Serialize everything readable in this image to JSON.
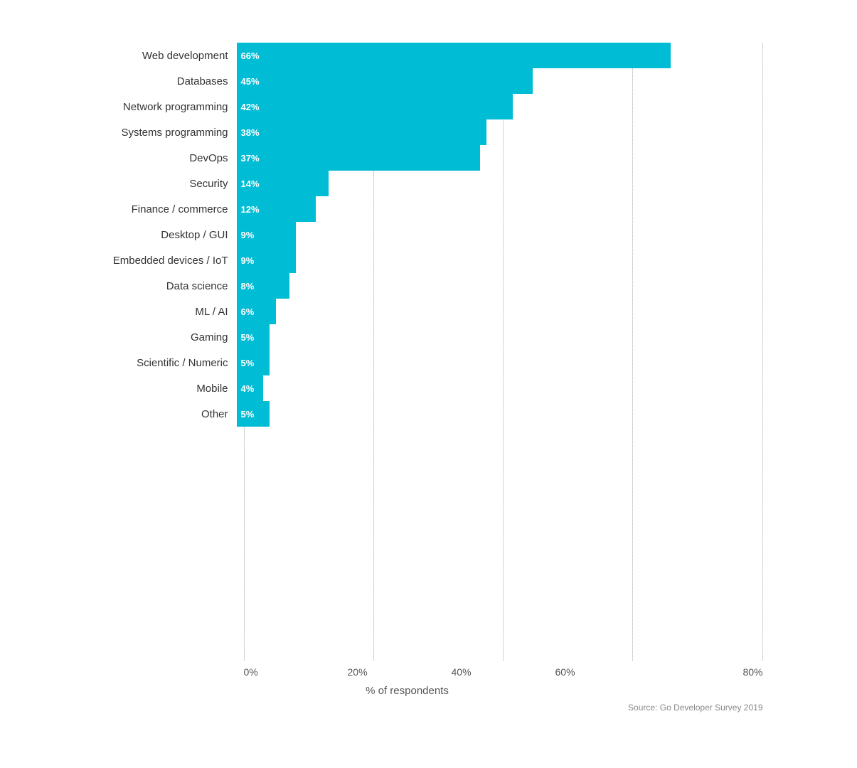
{
  "chart": {
    "title": "% of respondents",
    "source": "Source: Go Developer Survey 2019",
    "x_axis": {
      "labels": [
        "0%",
        "20%",
        "40%",
        "60%",
        "80%"
      ],
      "max": 80
    },
    "bars": [
      {
        "label": "Web development",
        "value": 66
      },
      {
        "label": "Databases",
        "value": 45
      },
      {
        "label": "Network programming",
        "value": 42
      },
      {
        "label": "Systems programming",
        "value": 38
      },
      {
        "label": "DevOps",
        "value": 37
      },
      {
        "label": "Security",
        "value": 14
      },
      {
        "label": "Finance / commerce",
        "value": 12
      },
      {
        "label": "Desktop / GUI",
        "value": 9
      },
      {
        "label": "Embedded devices / IoT",
        "value": 9
      },
      {
        "label": "Data science",
        "value": 8
      },
      {
        "label": "ML / AI",
        "value": 6
      },
      {
        "label": "Gaming",
        "value": 5
      },
      {
        "label": "Scientific / Numeric",
        "value": 5
      },
      {
        "label": "Mobile",
        "value": 4
      },
      {
        "label": "Other",
        "value": 5
      }
    ],
    "bar_color": "#00bcd4"
  }
}
